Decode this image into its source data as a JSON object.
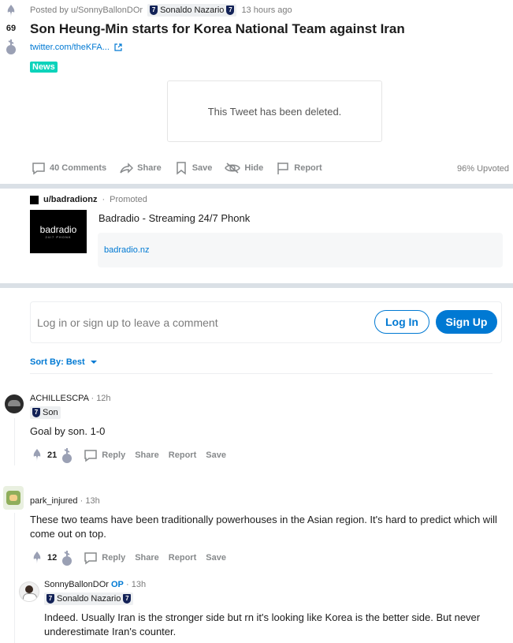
{
  "post": {
    "score": "69",
    "posted_by": "Posted by u/SonnyBallonDOr",
    "author_flair": "Sonaldo Nazario",
    "time": "13 hours ago",
    "title": "Son Heung-Min starts for Korea National Team against Iran",
    "link": "twitter.com/theKFA...",
    "tag": "News",
    "embed_text": "This Tweet has been deleted.",
    "actions": {
      "comments": "40 Comments",
      "share": "Share",
      "save": "Save",
      "hide": "Hide",
      "report": "Report"
    },
    "upvoted": "96% Upvoted"
  },
  "ad": {
    "user": "u/badradionz",
    "promoted": "Promoted",
    "logo_text": "badradio",
    "logo_sub": "24/7 PHONK",
    "title": "Badradio - Streaming 24/7 Phonk",
    "url": "badradio.nz"
  },
  "comment_box": {
    "prompt": "Log in or sign up to leave a comment",
    "login": "Log In",
    "signup": "Sign Up"
  },
  "sort": {
    "label": "Sort By: Best"
  },
  "comments": [
    {
      "user": "ACHILLESCPA",
      "time": "12h",
      "flair": "Son",
      "text": "Goal by son. 1-0",
      "score": "21"
    },
    {
      "user": "park_injured",
      "time": "13h",
      "text": "These two teams have been traditionally powerhouses in the Asian region. It's hard to predict which will come out on top.",
      "score": "12"
    },
    {
      "user": "SonnyBallonDOr",
      "op": "OP",
      "time": "13h",
      "flair": "Sonaldo Nazario",
      "text": "Indeed. Usually Iran is the stronger side but rn it's looking like Korea is the better side. But never underestimate Iran's counter."
    }
  ],
  "comment_actions": {
    "reply": "Reply",
    "share": "Share",
    "report": "Report",
    "save": "Save"
  },
  "colors": {
    "accent": "#0079d3",
    "news_tag": "#0dd3bb",
    "divider": "#dae0e6"
  }
}
